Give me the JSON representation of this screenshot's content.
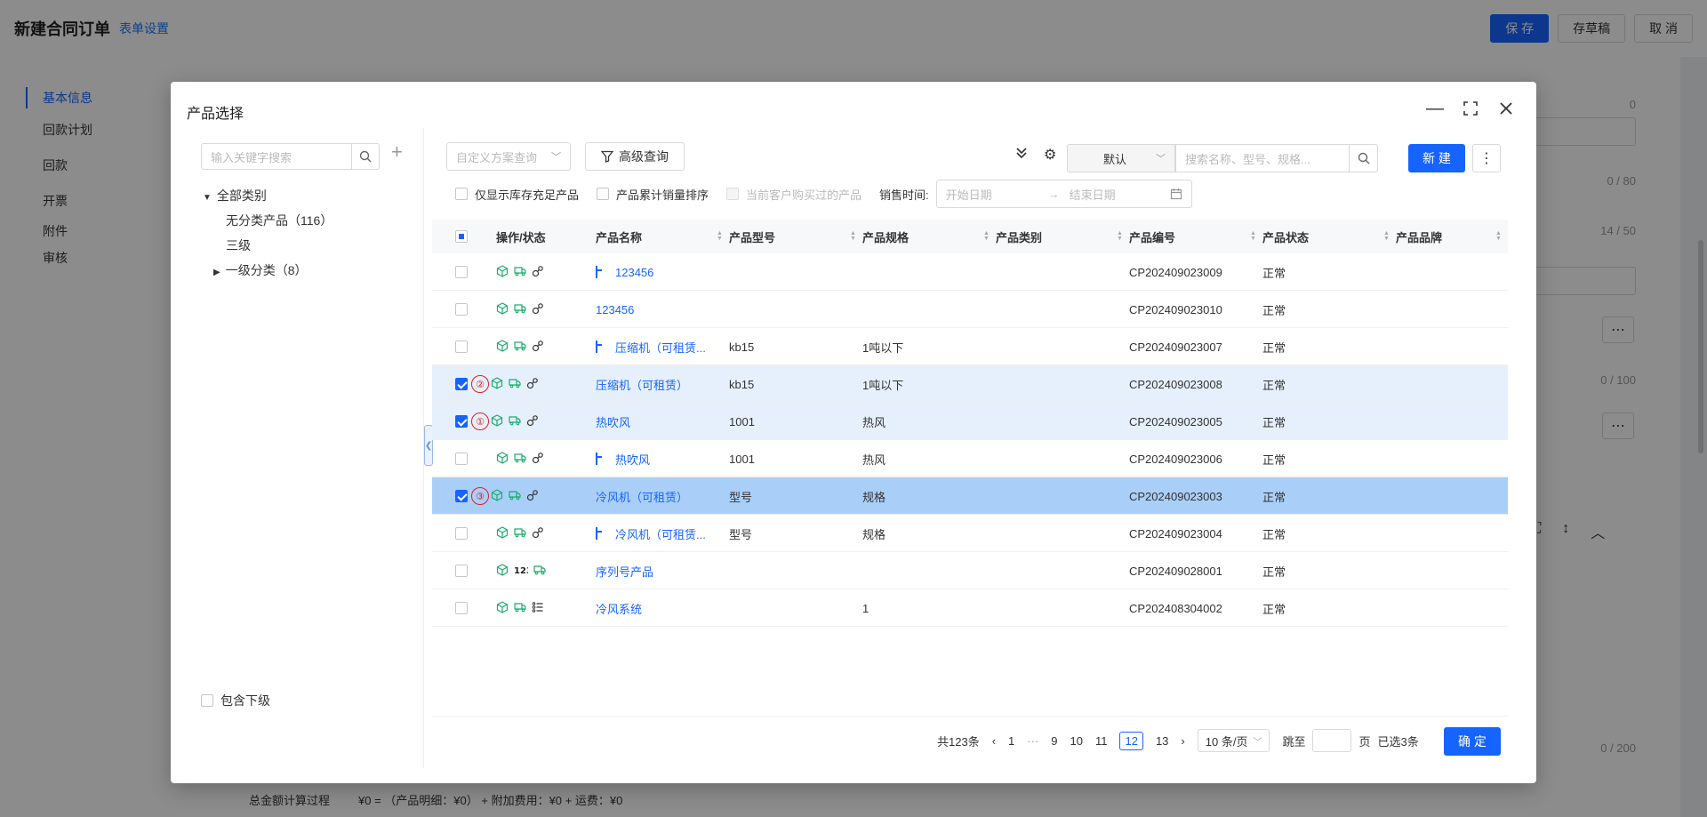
{
  "page": {
    "title": "新建合同订单",
    "settings_link": "表单设置",
    "buttons": {
      "save": "保 存",
      "draft": "存草稿",
      "cancel": "取 消"
    },
    "nav": [
      "基本信息",
      "回款计划",
      "回款",
      "开票",
      "附件",
      "审核"
    ],
    "field_counts": [
      "0",
      "0 / 80",
      "14 / 50",
      "0 / 100",
      "0 / 200"
    ],
    "footer_label": "总金额计算过程",
    "footer_value": "¥0 = （产品明细：¥0） + 附加费用：¥0 + 运费：¥0"
  },
  "modal": {
    "title": "产品选择",
    "tree": {
      "search_placeholder": "输入关键字搜索",
      "root": "全部类别",
      "items": [
        "无分类产品（116）",
        "三级",
        "一级分类（8）"
      ],
      "include_sub": "包含下级"
    },
    "toolbar": {
      "scheme_placeholder": "自定义方案查询",
      "advanced": "高级查询",
      "sort_value": "默认",
      "search_placeholder": "搜索名称、型号、规格...",
      "new": "新 建"
    },
    "filters": {
      "stock_only": "仅显示库存充足产品",
      "sales_sort": "产品累计销量排序",
      "customer_bought": "当前客户购买过的产品",
      "sale_time_label": "销售时间:",
      "start_placeholder": "开始日期",
      "end_placeholder": "结束日期"
    },
    "columns": [
      "操作/状态",
      "产品名称",
      "产品型号",
      "产品规格",
      "产品类别",
      "产品编号",
      "产品状态",
      "产品品牌"
    ],
    "rows": [
      {
        "checked": false,
        "mark": "",
        "child": true,
        "name": "123456",
        "model": "",
        "spec": "",
        "code": "CP202409023009",
        "status": "正常",
        "state": "normal"
      },
      {
        "checked": false,
        "mark": "",
        "child": false,
        "name": "123456",
        "model": "",
        "spec": "",
        "code": "CP202409023010",
        "status": "正常",
        "state": "normal"
      },
      {
        "checked": false,
        "mark": "",
        "child": true,
        "name": "压缩机（可租赁...",
        "model": "kb15",
        "spec": "1吨以下",
        "code": "CP202409023007",
        "status": "正常",
        "state": "normal"
      },
      {
        "checked": true,
        "mark": "②",
        "child": false,
        "name": "压缩机（可租赁）",
        "model": "kb15",
        "spec": "1吨以下",
        "code": "CP202409023008",
        "status": "正常",
        "state": "sel"
      },
      {
        "checked": true,
        "mark": "①",
        "child": false,
        "name": "热吹风",
        "model": "1001",
        "spec": "热风",
        "code": "CP202409023005",
        "status": "正常",
        "state": "sel"
      },
      {
        "checked": false,
        "mark": "",
        "child": true,
        "name": "热吹风",
        "model": "1001",
        "spec": "热风",
        "code": "CP202409023006",
        "status": "正常",
        "state": "normal"
      },
      {
        "checked": true,
        "mark": "③",
        "child": false,
        "name": "冷风机（可租赁）",
        "model": "型号",
        "spec": "规格",
        "code": "CP202409023003",
        "status": "正常",
        "state": "cur"
      },
      {
        "checked": false,
        "mark": "",
        "child": true,
        "name": "冷风机（可租赁...",
        "model": "型号",
        "spec": "规格",
        "code": "CP202409023004",
        "status": "正常",
        "state": "normal"
      },
      {
        "checked": false,
        "mark": "",
        "child": false,
        "name": "序列号产品",
        "model": "",
        "spec": "",
        "code": "CP202409028001",
        "status": "正常",
        "state": "normal",
        "ops_alt": "serial"
      },
      {
        "checked": false,
        "mark": "",
        "child": false,
        "name": "冷风系统",
        "model": "",
        "spec": "1",
        "code": "CP202408304002",
        "status": "正常",
        "state": "normal",
        "ops_alt": "list"
      }
    ],
    "pager": {
      "total": "共123条",
      "pages": [
        "1",
        "9",
        "10",
        "11",
        "12",
        "13"
      ],
      "current": "12",
      "ellipsis": "···",
      "size": "10 条/页",
      "jump_label": "跳至",
      "page_unit": "页",
      "selected": "已选3条",
      "confirm": "确 定"
    }
  }
}
